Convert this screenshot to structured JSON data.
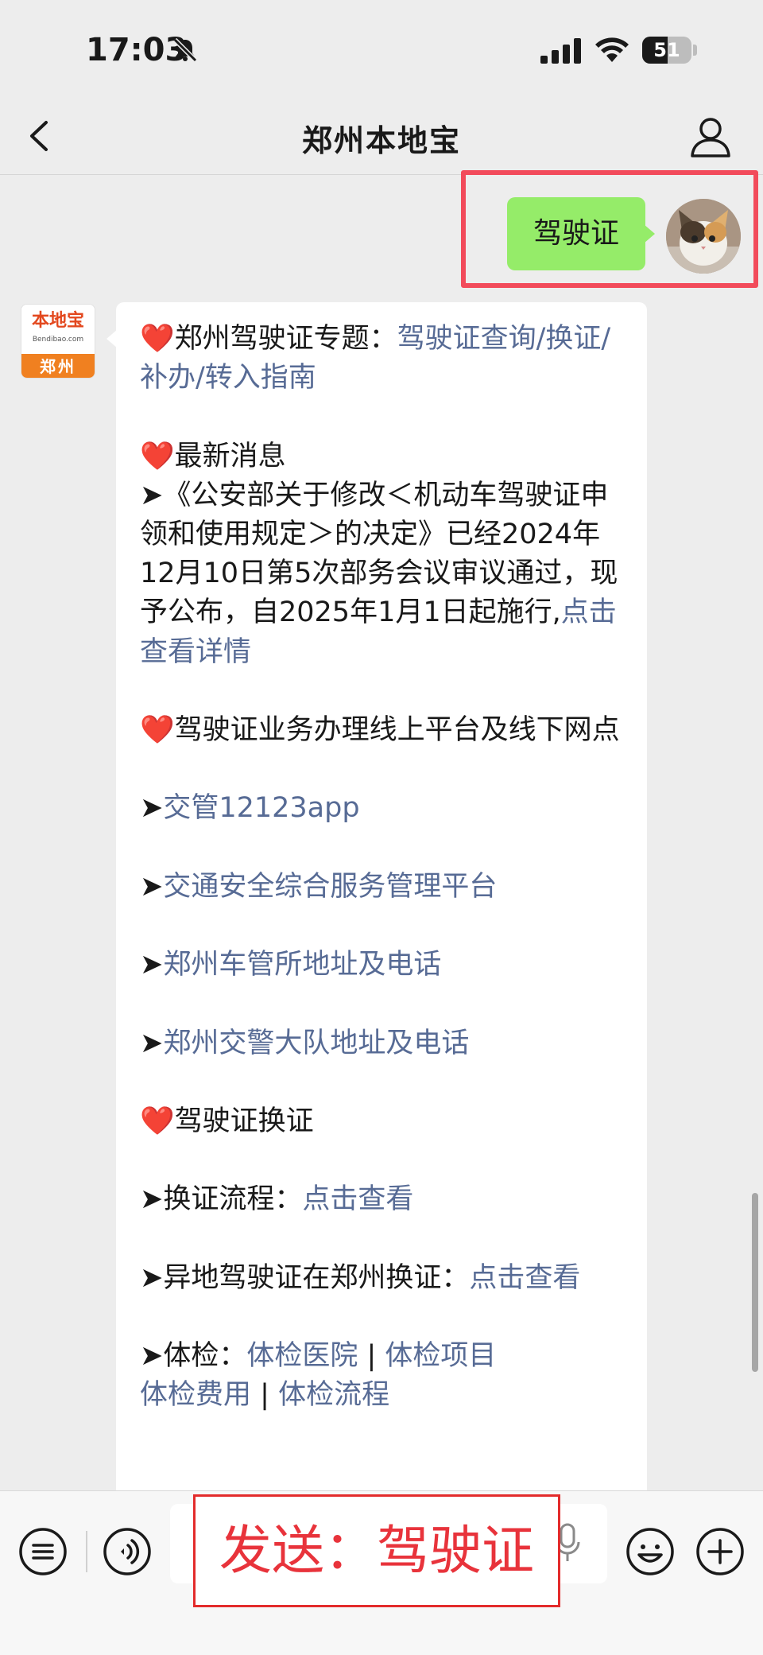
{
  "status": {
    "time": "17:03",
    "battery": "51",
    "battery_level": 0.51
  },
  "nav": {
    "title": "郑州本地宝"
  },
  "outgoing": {
    "text": "驾驶证"
  },
  "logo": {
    "main": "本地宝",
    "sub": "Bendibao.com",
    "city": "郑州"
  },
  "message": {
    "l1_prefix": "❤️郑州驾驶证专题：",
    "l1_link": "驾驶证查询/换证/补办/转入指南",
    "l2": "❤️最新消息",
    "l3": "➤《公安部关于修改＜机动车驾驶证申领和使用规定＞的决定》已经2024年12月10日第5次部务会议审议通过，现予公布，自2025年1月1日起施行,",
    "l3_link": "点击查看详情",
    "l4": "❤️驾驶证业务办理线上平台及线下网点",
    "l5_prefix": "➤",
    "l5_link": "交管12123app",
    "l6_prefix": "➤",
    "l6_link": "交通安全综合服务管理平台",
    "l7_prefix": "➤",
    "l7_link": "郑州车管所地址及电话",
    "l8_prefix": "➤",
    "l8_link": "郑州交警大队地址及电话",
    "l9": "❤️驾驶证换证",
    "l10_prefix": "➤换证流程：",
    "l10_link": "点击查看",
    "l11_prefix": "➤异地驾驶证在郑州换证：",
    "l11_link": "点击查看",
    "l12_prefix": "➤体检：",
    "l12_link1": "体检医院",
    "l12_sep1": " | ",
    "l12_link2": "体检项目",
    "l12_link3": "体检费用",
    "l12_sep2": " | ",
    "l12_link4": "体检流程"
  },
  "overlay": {
    "send_label": "发送：驾驶证"
  },
  "colors": {
    "outgoing_bubble": "#95ec69",
    "link": "#576b95",
    "highlight": "#f24b5b"
  }
}
